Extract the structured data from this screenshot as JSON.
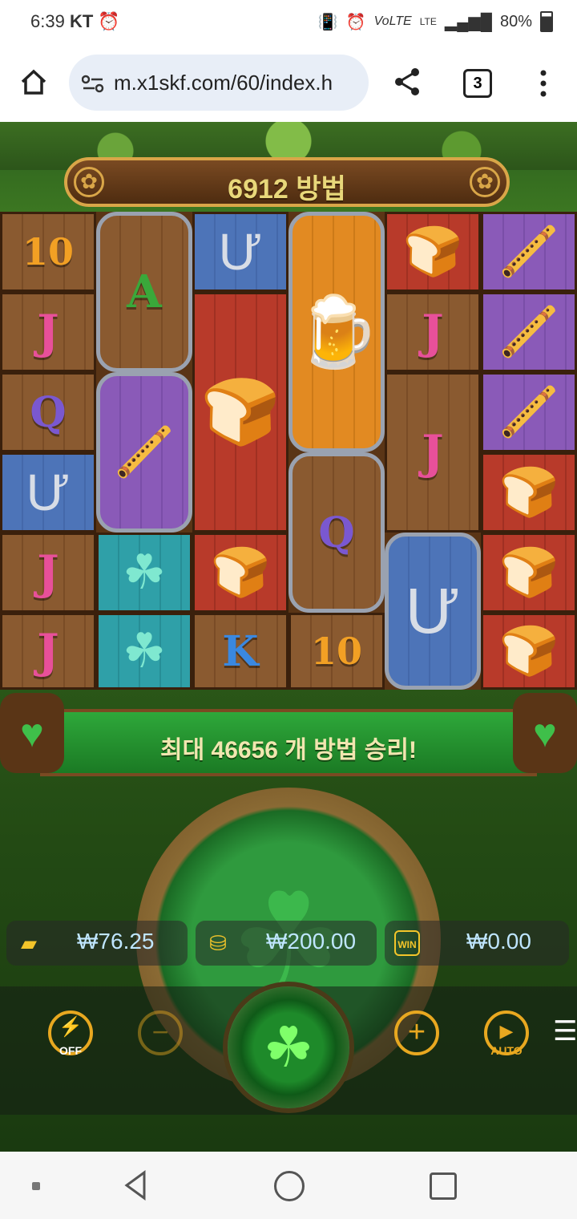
{
  "status": {
    "time": "6:39",
    "carrier": "KT",
    "battery": "80%",
    "signal": "LTE"
  },
  "browser": {
    "url": "m.x1skf.com/60/index.h",
    "tab_count": "3"
  },
  "game": {
    "ways_banner": "6912 방법",
    "max_ways_banner": "최대 46656 개 방법 승리!",
    "balance": "₩76.25",
    "bet": "₩200.00",
    "win": "₩0.00",
    "win_label": "WIN",
    "turbo_label": "OFF",
    "auto_label": "AUTO",
    "minus": "−",
    "plus": "+",
    "menu": "☰",
    "symbols": {
      "ten": "10",
      "j": "J",
      "q": "Q",
      "a": "A",
      "k": "K"
    }
  },
  "icons": {
    "home": "home-icon",
    "share": "share-icon",
    "more": "more-icon"
  }
}
